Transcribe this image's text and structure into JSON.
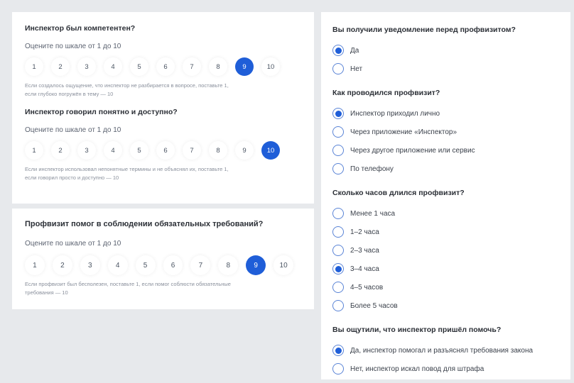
{
  "card_a": {
    "q1": {
      "title": "Инспектор был компетентен?",
      "sub": "Оцените по шкале от 1 до 10",
      "scale": [
        "1",
        "2",
        "3",
        "4",
        "5",
        "6",
        "7",
        "8",
        "9",
        "10"
      ],
      "selected": "9",
      "hint_line1": "Если создалось ощущение, что инспектор не разбирается в вопросе, поставьте 1,",
      "hint_line2": "если глубоко погружён в тему — 10"
    },
    "q2": {
      "title": "Инспектор говорил понятно и доступно?",
      "sub": "Оцените по шкале от 1 до 10",
      "scale": [
        "1",
        "2",
        "3",
        "4",
        "5",
        "6",
        "7",
        "8",
        "9",
        "10"
      ],
      "selected": "10",
      "hint_line1": "Если инспектор использовал непонятные термины и не объяснял их, поставьте 1,",
      "hint_line2": "если говорил просто и доступно — 10"
    }
  },
  "card_b": {
    "title": "Профвизит помог в соблюдении обязательных требований?",
    "sub": "Оцените по шкале от 1 до 10",
    "scale": [
      "1",
      "2",
      "3",
      "4",
      "5",
      "6",
      "7",
      "8",
      "9",
      "10"
    ],
    "selected": "9",
    "hint_line1": "Если профвизит был бесполезен, поставьте 1, если помог соблюсти обязательные",
    "hint_line2": "требования — 10"
  },
  "card_c": {
    "g1": {
      "title": "Вы получили уведомление перед профвизитом?",
      "options": [
        {
          "label": "Да",
          "checked": true
        },
        {
          "label": "Нет",
          "checked": false
        }
      ]
    },
    "g2": {
      "title": "Как проводился профвизит?",
      "options": [
        {
          "label": "Инспектор приходил лично",
          "checked": true
        },
        {
          "label": "Через приложение «Инспектор»",
          "checked": false
        },
        {
          "label": "Через другое приложение или сервис",
          "checked": false
        },
        {
          "label": "По телефону",
          "checked": false
        }
      ]
    },
    "g3": {
      "title": "Сколько часов длился профвизит?",
      "options": [
        {
          "label": "Менее 1 часа",
          "checked": false
        },
        {
          "label": "1–2 часа",
          "checked": false
        },
        {
          "label": "2–3 часа",
          "checked": false
        },
        {
          "label": "3–4 часа",
          "checked": true
        },
        {
          "label": "4–5 часов",
          "checked": false
        },
        {
          "label": "Более 5 часов",
          "checked": false
        }
      ]
    },
    "g4": {
      "title": "Вы ощутили, что инспектор пришёл помочь?",
      "options": [
        {
          "label": "Да, инспектор помогал и разъяснял требования закона",
          "checked": true
        },
        {
          "label": "Нет, инспектор искал повод для штрафа",
          "checked": false
        }
      ]
    }
  },
  "colors": {
    "accent": "#1f5ed8",
    "background": "#e7e9ec",
    "radio_border": "#5a84d6"
  }
}
